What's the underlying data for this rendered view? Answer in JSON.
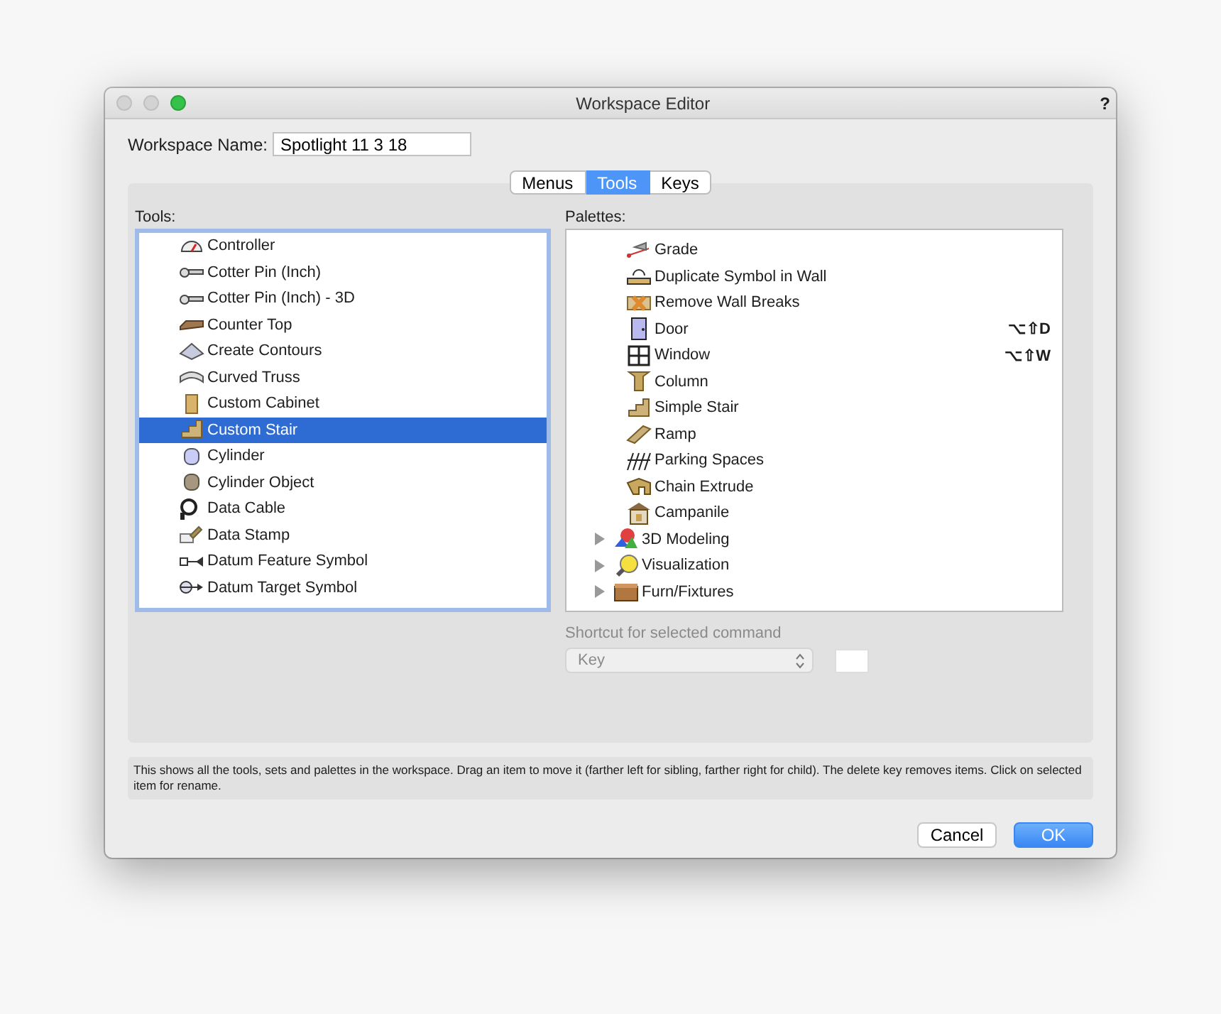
{
  "window": {
    "title": "Workspace Editor",
    "help": "?"
  },
  "workspace_name": {
    "label": "Workspace Name:",
    "value": "Spotlight 11 3 18"
  },
  "tabs": [
    {
      "label": "Menus",
      "selected": false
    },
    {
      "label": "Tools",
      "selected": true
    },
    {
      "label": "Keys",
      "selected": false
    }
  ],
  "tools": {
    "label": "Tools:",
    "items": [
      {
        "label": "Controller",
        "selected": false
      },
      {
        "label": "Cotter Pin (Inch)",
        "selected": false
      },
      {
        "label": "Cotter Pin (Inch) - 3D",
        "selected": false
      },
      {
        "label": "Counter Top",
        "selected": false
      },
      {
        "label": "Create Contours",
        "selected": false
      },
      {
        "label": "Curved Truss",
        "selected": false
      },
      {
        "label": "Custom Cabinet",
        "selected": false
      },
      {
        "label": "Custom Stair",
        "selected": true
      },
      {
        "label": "Cylinder",
        "selected": false
      },
      {
        "label": "Cylinder Object",
        "selected": false
      },
      {
        "label": "Data Cable",
        "selected": false
      },
      {
        "label": "Data Stamp",
        "selected": false
      },
      {
        "label": "Datum Feature Symbol",
        "selected": false
      },
      {
        "label": "Datum Target Symbol",
        "selected": false
      }
    ]
  },
  "palettes": {
    "label": "Palettes:",
    "tools": [
      {
        "label": "Grade"
      },
      {
        "label": "Duplicate Symbol in Wall"
      },
      {
        "label": "Remove Wall Breaks"
      },
      {
        "label": "Door",
        "shortcut": "⌥⇧D"
      },
      {
        "label": "Window",
        "shortcut": "⌥⇧W"
      },
      {
        "label": "Column"
      },
      {
        "label": "Simple Stair"
      },
      {
        "label": "Ramp"
      },
      {
        "label": "Parking Spaces"
      },
      {
        "label": "Chain Extrude"
      },
      {
        "label": "Campanile"
      }
    ],
    "groups": [
      {
        "label": "3D Modeling",
        "expanded": false
      },
      {
        "label": "Visualization",
        "expanded": false
      },
      {
        "label": "Furn/Fixtures",
        "expanded": false
      }
    ]
  },
  "shortcut": {
    "label": "Shortcut for selected command",
    "popup": "Key",
    "disabled": true
  },
  "help_text": "This shows all the tools, sets and palettes in the workspace. Drag an item to move it (farther left for sibling, farther right for child). The delete key removes items.  Click on selected item for rename.",
  "buttons": [
    {
      "label": "Cancel",
      "default": false
    },
    {
      "label": "OK",
      "default": true
    }
  ]
}
